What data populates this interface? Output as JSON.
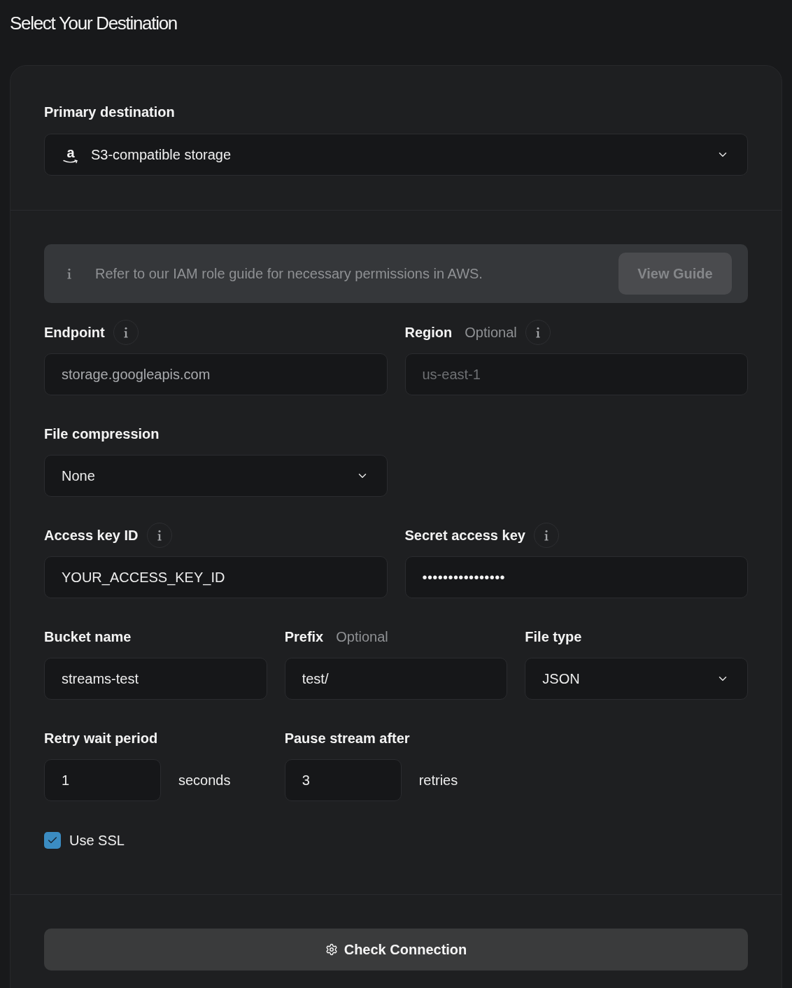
{
  "title": "Select Your Destination",
  "primary_destination": {
    "label": "Primary destination",
    "logo": "a",
    "value": "S3-compatible storage"
  },
  "notice": {
    "text": "Refer to our IAM role guide for necessary permissions in AWS.",
    "button": "View Guide"
  },
  "field_rows": [
    {
      "kind": "halves",
      "fields": [
        {
          "kind": "text",
          "label": "Endpoint",
          "info": true,
          "placeholder": "storage.googleapis.com",
          "disabled": false
        },
        {
          "kind": "text",
          "label": "Region",
          "optional": "Optional",
          "info": true,
          "placeholder": "us-east-1",
          "disabled": true
        }
      ]
    },
    {
      "kind": "halves",
      "fields": [
        {
          "kind": "select",
          "label": "File compression",
          "info": false,
          "value": "None"
        }
      ]
    },
    {
      "kind": "halves",
      "fields": [
        {
          "kind": "text",
          "label": "Access key ID",
          "info": true,
          "value": "YOUR_ACCESS_KEY_ID",
          "disabled": false
        },
        {
          "kind": "password",
          "label": "Secret access key",
          "info": true,
          "value": "••••••••••••••••"
        }
      ]
    },
    {
      "kind": "thirds",
      "fields": [
        {
          "kind": "text",
          "label": "Bucket name",
          "info": false,
          "value": "streams-test",
          "disabled": false
        },
        {
          "kind": "text",
          "label": "Prefix",
          "optional": "Optional",
          "info": false,
          "value": "test/",
          "disabled": false
        },
        {
          "kind": "select",
          "label": "File type",
          "info": false,
          "value": "JSON"
        }
      ]
    },
    {
      "kind": "thirds",
      "fields": [
        {
          "kind": "number",
          "label": "Retry wait period",
          "info": false,
          "value": "1",
          "unit": "seconds"
        },
        {
          "kind": "number",
          "label": "Pause stream after",
          "info": false,
          "value": "3",
          "unit": "retries"
        }
      ]
    }
  ],
  "use_ssl": {
    "label": "Use SSL",
    "checked": true
  },
  "submit": {
    "label": "Check Connection"
  }
}
